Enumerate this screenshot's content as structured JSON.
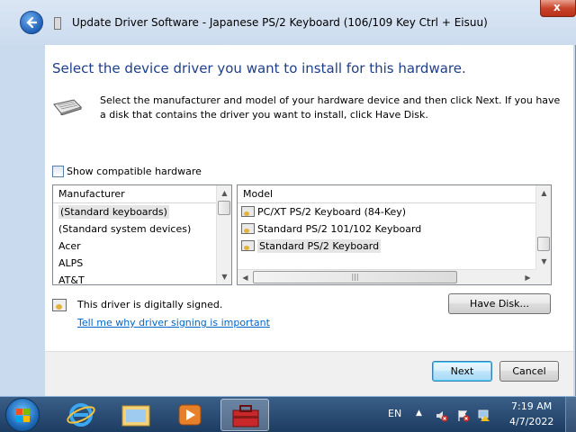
{
  "window": {
    "title": "Update Driver Software - Japanese PS/2 Keyboard (106/109 Key Ctrl + Eisuu)",
    "close_label": "x"
  },
  "main": {
    "heading": "Select the device driver you want to install for this hardware.",
    "description": "Select the manufacturer and model of your hardware device and then click Next. If you have a disk that contains the driver you want to install, click Have Disk.",
    "show_compatible_label": "Show compatible hardware",
    "show_compatible_checked": false,
    "manufacturer": {
      "header": "Manufacturer",
      "items": [
        "(Standard keyboards)",
        "(Standard system devices)",
        "Acer",
        "ALPS",
        "AT&T"
      ],
      "selected": "(Standard keyboards)"
    },
    "model": {
      "header": "Model",
      "items": [
        "PC/XT PS/2 Keyboard (84-Key)",
        "Standard PS/2 101/102 Keyboard",
        "Standard PS/2 Keyboard"
      ],
      "selected": "Standard PS/2 Keyboard"
    },
    "signed_text": "This driver is digitally signed.",
    "signing_link": "Tell me why driver signing is important",
    "have_disk_label": "Have Disk..."
  },
  "buttons": {
    "next": "Next",
    "cancel": "Cancel"
  },
  "taskbar": {
    "language": "EN",
    "time": "7:19 AM",
    "date": "4/7/2022"
  }
}
